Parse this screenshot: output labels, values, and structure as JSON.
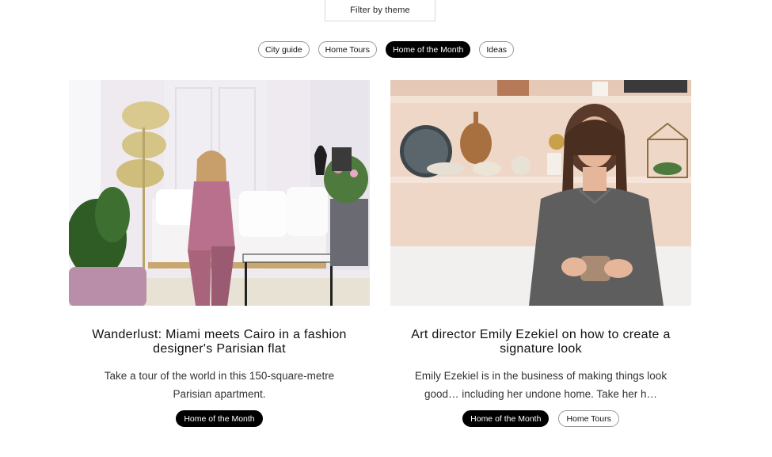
{
  "filter": {
    "label": "Filter by theme"
  },
  "chips": [
    {
      "label": "City guide",
      "active": false
    },
    {
      "label": "Home Tours",
      "active": false
    },
    {
      "label": "Home of the Month",
      "active": true
    },
    {
      "label": "Ideas",
      "active": false
    }
  ],
  "articles": [
    {
      "title": "Wanderlust: Miami meets Cairo in a fashion designer's Parisian flat",
      "excerpt": "Take a tour of the world in this 150-square-metre Parisian apartment.",
      "tags": [
        {
          "label": "Home of the Month",
          "filled": true
        }
      ]
    },
    {
      "title": "Art director Emily Ezekiel on how to create a signature look",
      "excerpt": "Emily Ezekiel is in the business of making things look good… including her undone home. Take her h…",
      "tags": [
        {
          "label": "Home of the Month",
          "filled": true
        },
        {
          "label": "Home Tours",
          "filled": false
        }
      ]
    }
  ]
}
